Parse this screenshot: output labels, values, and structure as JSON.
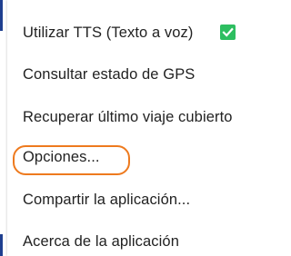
{
  "menu": {
    "items": [
      {
        "label": "Utilizar TTS (Texto a voz)",
        "checked": true
      },
      {
        "label": "Consultar estado de GPS"
      },
      {
        "label": "Recuperar último viaje cubierto"
      },
      {
        "label": "Opciones..."
      },
      {
        "label": "Compartir la aplicación..."
      },
      {
        "label": "Acerca de la aplicación"
      }
    ]
  },
  "colors": {
    "checkbox": "#2dbe60",
    "highlight_ring": "#ee7a1e",
    "edge_strip": "#1f3f8f"
  },
  "icons": {
    "checkbox": "check-icon"
  }
}
